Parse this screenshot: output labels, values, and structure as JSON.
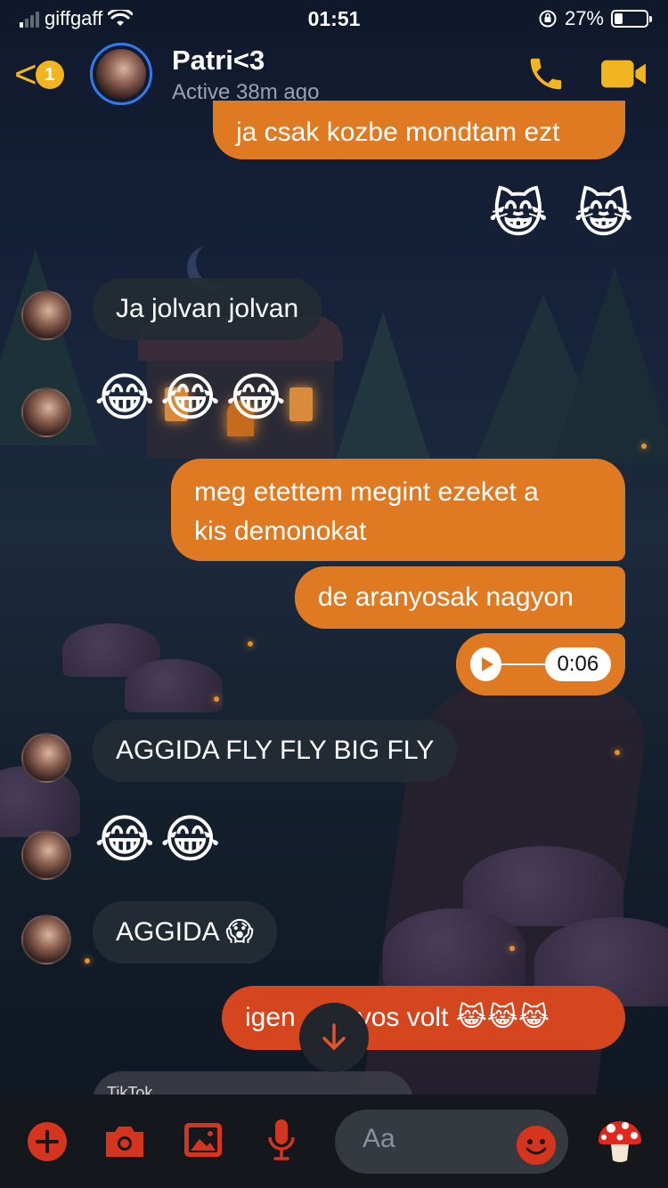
{
  "status_bar": {
    "carrier": "giffgaff",
    "time": "01:51",
    "battery": "27%",
    "battery_level": 0.27
  },
  "header": {
    "back_badge": "1",
    "contact_name": "Patri<3",
    "active_status": "Active 38m ago"
  },
  "messages": {
    "m1": "ja csak kozbe mondtam ezt",
    "m2_emoji": "😹 😹",
    "m3": "Ja jolvan jolvan",
    "m4_emoji": "😂😂😂",
    "m5_line1": "meg etettem megint ezeket a",
    "m5_line2": "kis demonokat",
    "m6": "de aranyosak nagyon",
    "audio_duration": "0:06",
    "m7": "AGGIDA FLY FLY BIG FLY",
    "m8_emoji": "😂😂",
    "m9": "AGGIDA 😱",
    "m10_a": "igen",
    "m10_b": "yos volt 😹😹😹",
    "tiktok_label": "TikTok"
  },
  "composer": {
    "placeholder": "Aa"
  },
  "colors": {
    "accent": "#f2b51f",
    "outgoing": "#e07a22",
    "outgoing_last": "#d5461f",
    "incoming": "#242c34",
    "composer_icons": "#d5341f"
  }
}
